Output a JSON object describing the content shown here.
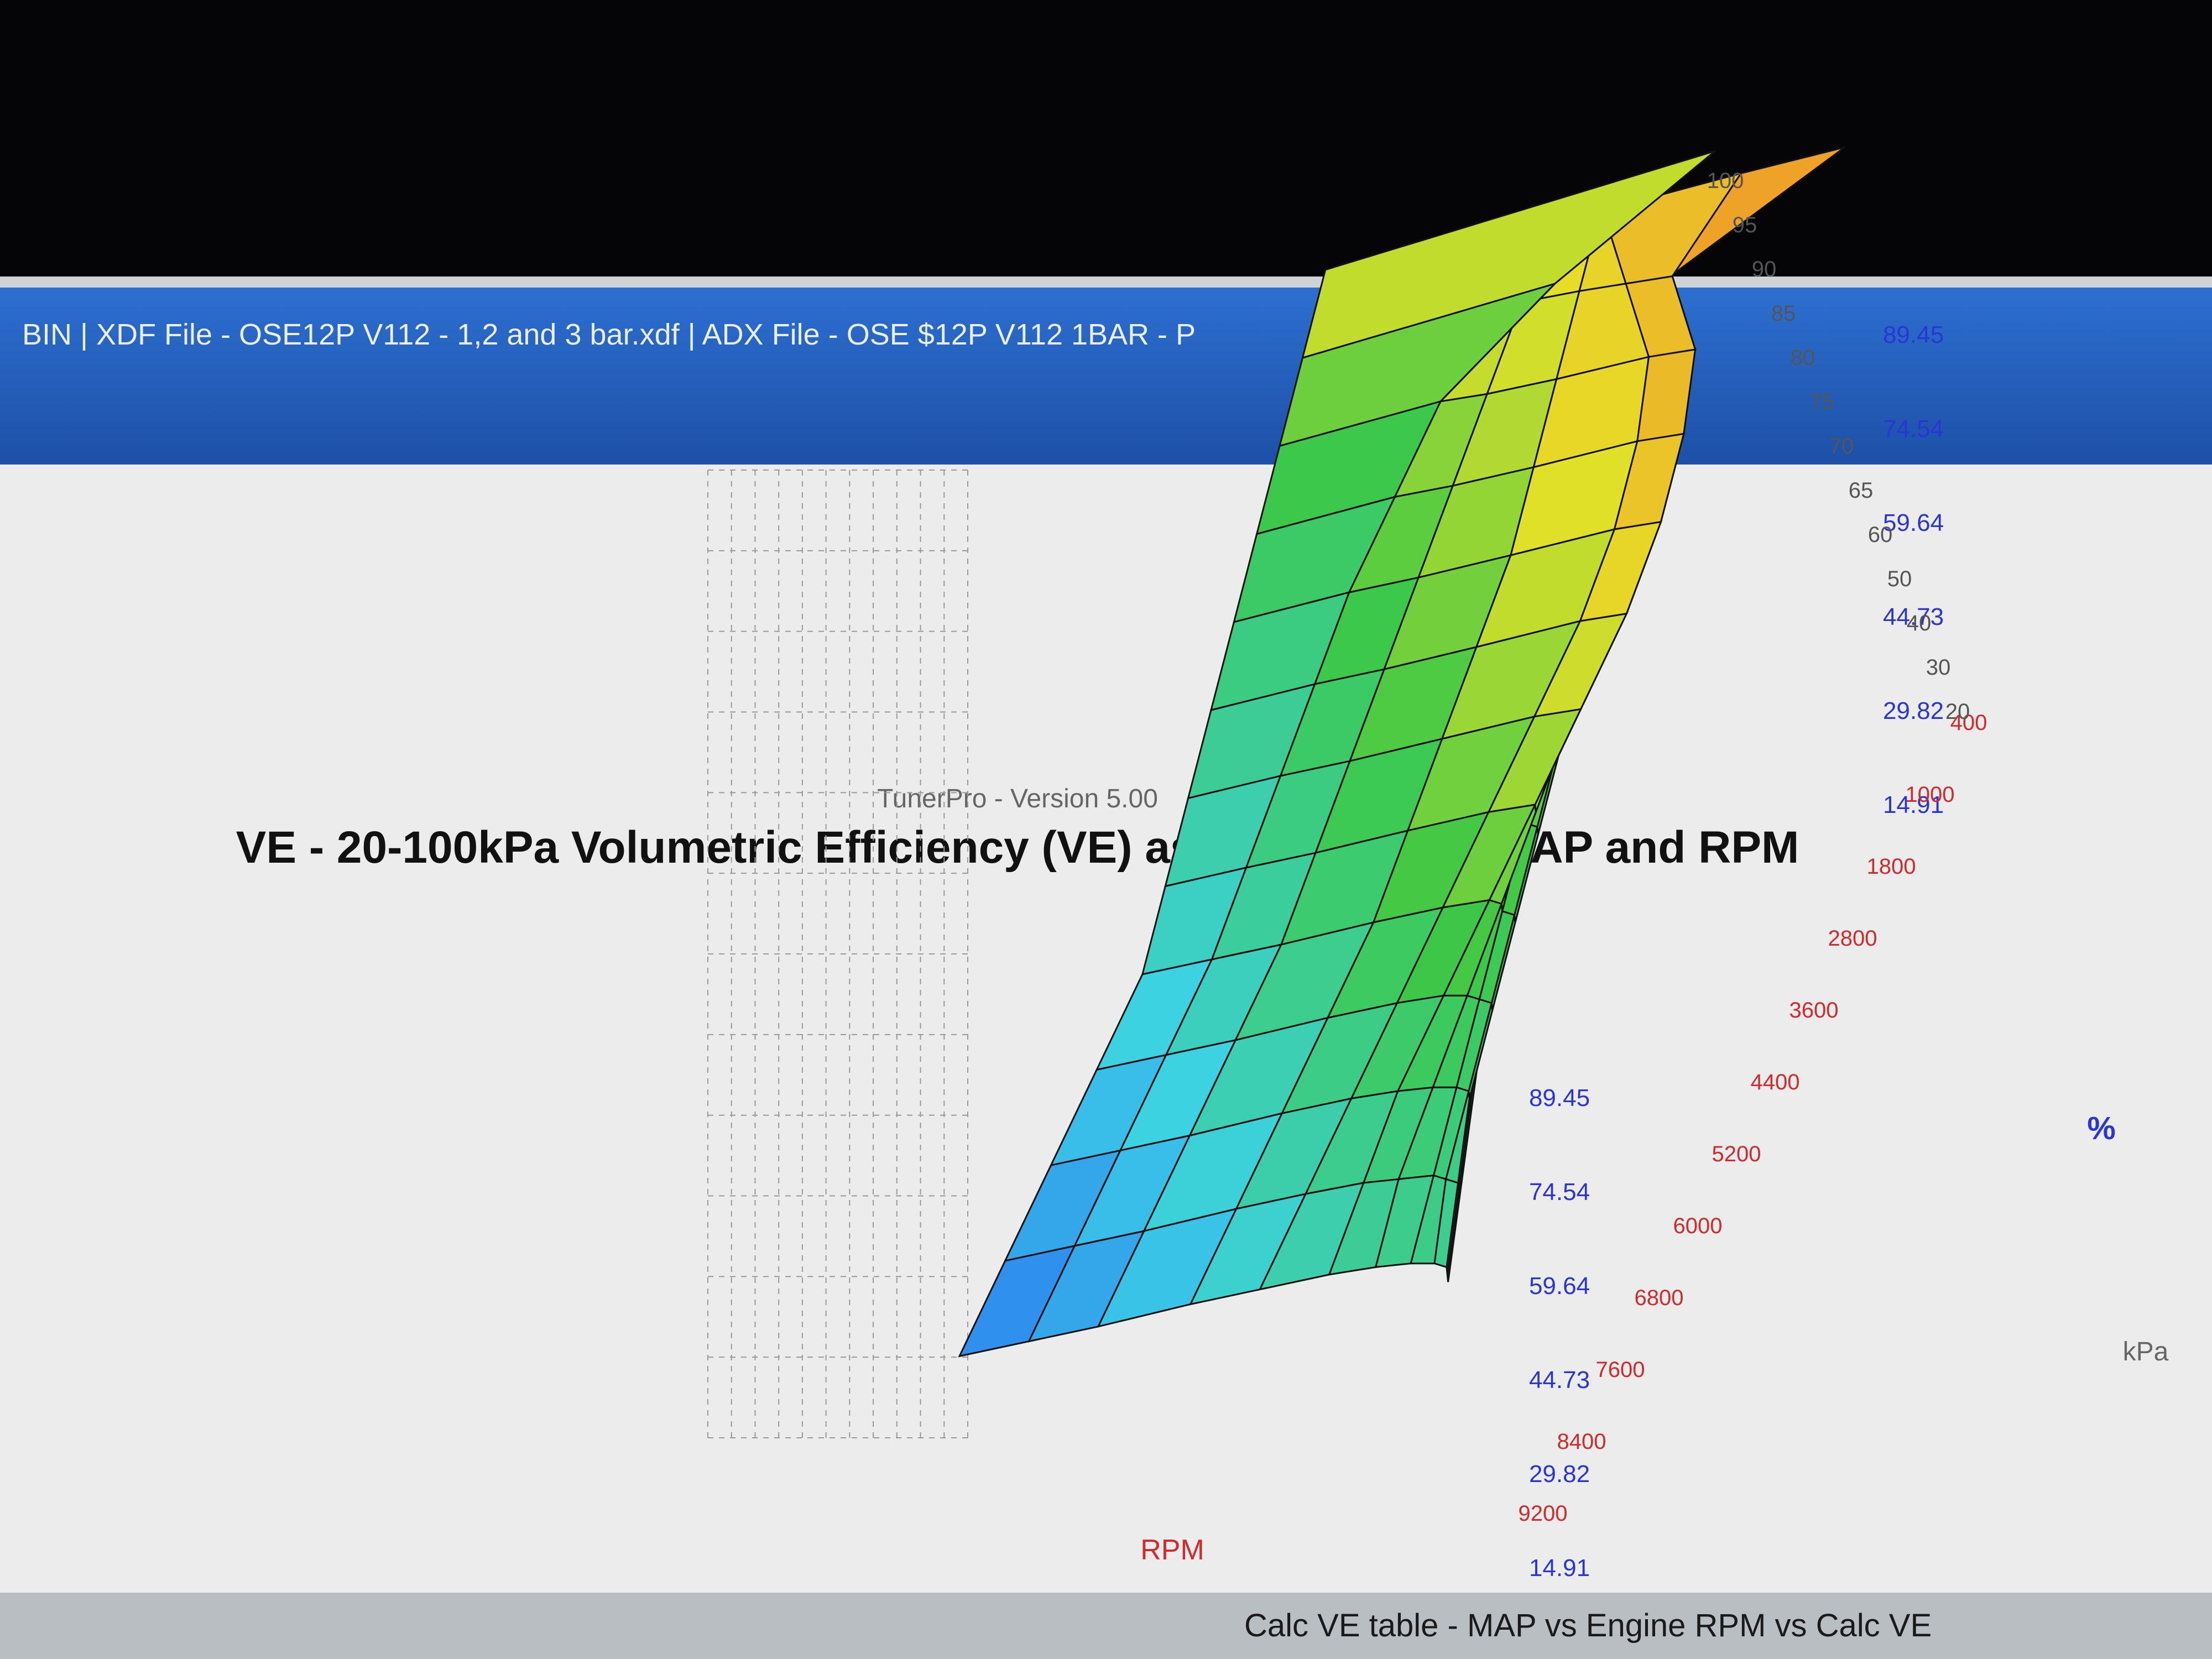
{
  "window": {
    "title": "BIN | XDF File - OSE12P V112 - 1,2 and 3 bar.xdf | ADX File - OSE $12P V112 1BAR - P"
  },
  "status_tab": {
    "label": "Calc VE table - MAP vs Engine RPM vs Calc VE"
  },
  "chart": {
    "subtitle": "TunerPro - Version 5.00",
    "title": "VE - 20-100kPa Volumetric Efficiency (VE) as a function of MAP and RPM",
    "unit": "%",
    "rpm_axis_name": "RPM",
    "kpa_axis_name": "kPa"
  },
  "chart_data": {
    "type": "surface",
    "title": "VE - 20-100kPa Volumetric Efficiency (VE) as a function of MAP and RPM",
    "zlabel": "%",
    "z_ticks": [
      "89.45",
      "74.54",
      "59.64",
      "44.73",
      "29.82",
      "14.91"
    ],
    "zlim": [
      0,
      89.45
    ],
    "rpm_ticks": [
      "400",
      "1000",
      "1800",
      "2800",
      "3600",
      "4400",
      "5200",
      "6000",
      "6800",
      "7600",
      "8400",
      "9200"
    ],
    "kpa_ticks": [
      "20",
      "30",
      "40",
      "50",
      "60",
      "65",
      "70",
      "75",
      "80",
      "85",
      "90",
      "95",
      "100"
    ],
    "rpm": [
      400,
      1000,
      1800,
      2800,
      3600,
      4400,
      5200,
      6000,
      6800,
      7600,
      8400,
      9200
    ],
    "kpa": [
      20,
      30,
      40,
      50,
      60,
      65,
      70,
      75,
      80,
      85,
      90,
      95,
      100
    ],
    "ve": [
      [
        22,
        26,
        30,
        34,
        38,
        40,
        42,
        44,
        46,
        48,
        50,
        52,
        54
      ],
      [
        26,
        30,
        34,
        38,
        42,
        45,
        48,
        51,
        54,
        58,
        62,
        72,
        86
      ],
      [
        30,
        34,
        38,
        42,
        46,
        49,
        52,
        55,
        58,
        61,
        64,
        67,
        70
      ],
      [
        36,
        40,
        44,
        48,
        52,
        55,
        58,
        61,
        64,
        66,
        68,
        70,
        72
      ],
      [
        40,
        44,
        48,
        52,
        56,
        60,
        64,
        68,
        71,
        73,
        74,
        72,
        70
      ],
      [
        44,
        47,
        50,
        54,
        58,
        62,
        66,
        70,
        73,
        75,
        76,
        74,
        80
      ],
      [
        46,
        48,
        51,
        54,
        57,
        60,
        63,
        66,
        69,
        71,
        72,
        70,
        87
      ],
      [
        47,
        49,
        51,
        53,
        55,
        57,
        59,
        61,
        63,
        64,
        65,
        66,
        67
      ],
      [
        47,
        48,
        50,
        52,
        54,
        56,
        58,
        60,
        62,
        63,
        64,
        64,
        64
      ],
      [
        46,
        47,
        48,
        50,
        52,
        54,
        56,
        57,
        58,
        59,
        60,
        60,
        60
      ],
      [
        44,
        45,
        46,
        47,
        48,
        49,
        50,
        51,
        52,
        53,
        54,
        55,
        56
      ],
      [
        42,
        43,
        44,
        45,
        46,
        46,
        47,
        47,
        48,
        48,
        49,
        49,
        50
      ]
    ],
    "grid": true
  }
}
